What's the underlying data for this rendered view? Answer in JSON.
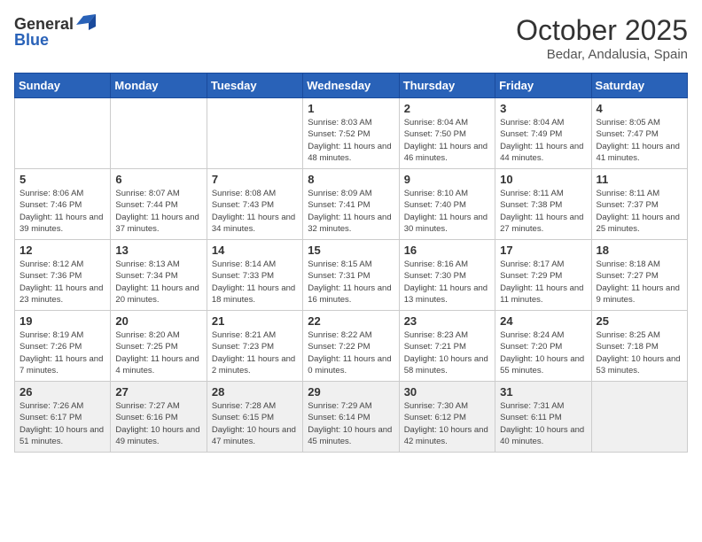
{
  "logo": {
    "general": "General",
    "blue": "Blue"
  },
  "title": "October 2025",
  "subtitle": "Bedar, Andalusia, Spain",
  "days_of_week": [
    "Sunday",
    "Monday",
    "Tuesday",
    "Wednesday",
    "Thursday",
    "Friday",
    "Saturday"
  ],
  "weeks": [
    [
      {
        "day": "",
        "info": ""
      },
      {
        "day": "",
        "info": ""
      },
      {
        "day": "",
        "info": ""
      },
      {
        "day": "1",
        "info": "Sunrise: 8:03 AM\nSunset: 7:52 PM\nDaylight: 11 hours and 48 minutes."
      },
      {
        "day": "2",
        "info": "Sunrise: 8:04 AM\nSunset: 7:50 PM\nDaylight: 11 hours and 46 minutes."
      },
      {
        "day": "3",
        "info": "Sunrise: 8:04 AM\nSunset: 7:49 PM\nDaylight: 11 hours and 44 minutes."
      },
      {
        "day": "4",
        "info": "Sunrise: 8:05 AM\nSunset: 7:47 PM\nDaylight: 11 hours and 41 minutes."
      }
    ],
    [
      {
        "day": "5",
        "info": "Sunrise: 8:06 AM\nSunset: 7:46 PM\nDaylight: 11 hours and 39 minutes."
      },
      {
        "day": "6",
        "info": "Sunrise: 8:07 AM\nSunset: 7:44 PM\nDaylight: 11 hours and 37 minutes."
      },
      {
        "day": "7",
        "info": "Sunrise: 8:08 AM\nSunset: 7:43 PM\nDaylight: 11 hours and 34 minutes."
      },
      {
        "day": "8",
        "info": "Sunrise: 8:09 AM\nSunset: 7:41 PM\nDaylight: 11 hours and 32 minutes."
      },
      {
        "day": "9",
        "info": "Sunrise: 8:10 AM\nSunset: 7:40 PM\nDaylight: 11 hours and 30 minutes."
      },
      {
        "day": "10",
        "info": "Sunrise: 8:11 AM\nSunset: 7:38 PM\nDaylight: 11 hours and 27 minutes."
      },
      {
        "day": "11",
        "info": "Sunrise: 8:11 AM\nSunset: 7:37 PM\nDaylight: 11 hours and 25 minutes."
      }
    ],
    [
      {
        "day": "12",
        "info": "Sunrise: 8:12 AM\nSunset: 7:36 PM\nDaylight: 11 hours and 23 minutes."
      },
      {
        "day": "13",
        "info": "Sunrise: 8:13 AM\nSunset: 7:34 PM\nDaylight: 11 hours and 20 minutes."
      },
      {
        "day": "14",
        "info": "Sunrise: 8:14 AM\nSunset: 7:33 PM\nDaylight: 11 hours and 18 minutes."
      },
      {
        "day": "15",
        "info": "Sunrise: 8:15 AM\nSunset: 7:31 PM\nDaylight: 11 hours and 16 minutes."
      },
      {
        "day": "16",
        "info": "Sunrise: 8:16 AM\nSunset: 7:30 PM\nDaylight: 11 hours and 13 minutes."
      },
      {
        "day": "17",
        "info": "Sunrise: 8:17 AM\nSunset: 7:29 PM\nDaylight: 11 hours and 11 minutes."
      },
      {
        "day": "18",
        "info": "Sunrise: 8:18 AM\nSunset: 7:27 PM\nDaylight: 11 hours and 9 minutes."
      }
    ],
    [
      {
        "day": "19",
        "info": "Sunrise: 8:19 AM\nSunset: 7:26 PM\nDaylight: 11 hours and 7 minutes."
      },
      {
        "day": "20",
        "info": "Sunrise: 8:20 AM\nSunset: 7:25 PM\nDaylight: 11 hours and 4 minutes."
      },
      {
        "day": "21",
        "info": "Sunrise: 8:21 AM\nSunset: 7:23 PM\nDaylight: 11 hours and 2 minutes."
      },
      {
        "day": "22",
        "info": "Sunrise: 8:22 AM\nSunset: 7:22 PM\nDaylight: 11 hours and 0 minutes."
      },
      {
        "day": "23",
        "info": "Sunrise: 8:23 AM\nSunset: 7:21 PM\nDaylight: 10 hours and 58 minutes."
      },
      {
        "day": "24",
        "info": "Sunrise: 8:24 AM\nSunset: 7:20 PM\nDaylight: 10 hours and 55 minutes."
      },
      {
        "day": "25",
        "info": "Sunrise: 8:25 AM\nSunset: 7:18 PM\nDaylight: 10 hours and 53 minutes."
      }
    ],
    [
      {
        "day": "26",
        "info": "Sunrise: 7:26 AM\nSunset: 6:17 PM\nDaylight: 10 hours and 51 minutes."
      },
      {
        "day": "27",
        "info": "Sunrise: 7:27 AM\nSunset: 6:16 PM\nDaylight: 10 hours and 49 minutes."
      },
      {
        "day": "28",
        "info": "Sunrise: 7:28 AM\nSunset: 6:15 PM\nDaylight: 10 hours and 47 minutes."
      },
      {
        "day": "29",
        "info": "Sunrise: 7:29 AM\nSunset: 6:14 PM\nDaylight: 10 hours and 45 minutes."
      },
      {
        "day": "30",
        "info": "Sunrise: 7:30 AM\nSunset: 6:12 PM\nDaylight: 10 hours and 42 minutes."
      },
      {
        "day": "31",
        "info": "Sunrise: 7:31 AM\nSunset: 6:11 PM\nDaylight: 10 hours and 40 minutes."
      },
      {
        "day": "",
        "info": ""
      }
    ]
  ]
}
